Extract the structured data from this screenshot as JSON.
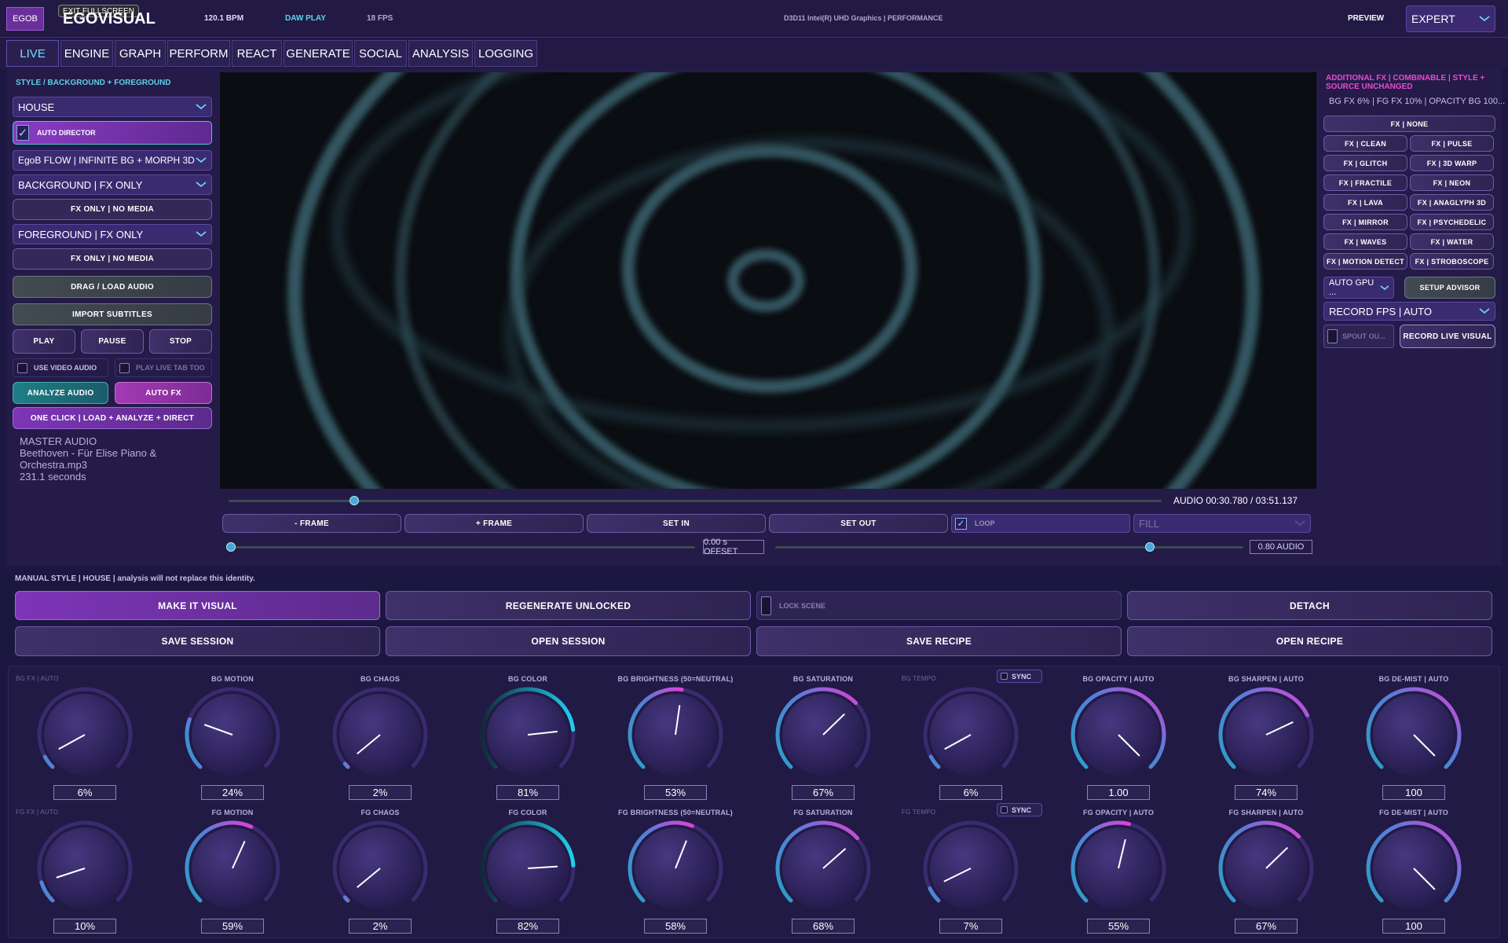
{
  "topbar": {
    "logo_badge": "EGOB",
    "exit_fullscreen": "EXIT FULLSCREEN",
    "app_title": "EGOVISUAL",
    "bpm": "120.1 BPM",
    "daw_play": "DAW PLAY",
    "fps": "18 FPS",
    "gpu": "D3D11  Intel(R) UHD Graphics | PERFORMANCE",
    "preview": "PREVIEW",
    "mode": "EXPERT"
  },
  "tabs": [
    "LIVE",
    "ENGINE",
    "GRAPH",
    "PERFORM",
    "REACT",
    "GENERATE",
    "SOCIAL",
    "ANALYSIS",
    "LOGGING"
  ],
  "left": {
    "section_label": "STYLE / BACKGROUND + FOREGROUND",
    "style_select": "HOUSE",
    "auto_director": "AUTO DIRECTOR",
    "flow_select": "EgoB FLOW | INFINITE BG + MORPH 3D",
    "background_select": "BACKGROUND | FX ONLY",
    "bg_media": "FX ONLY | NO MEDIA",
    "foreground_select": "FOREGROUND | FX ONLY",
    "fg_media": "FX ONLY | NO MEDIA",
    "load_audio": "DRAG / LOAD AUDIO",
    "import_subtitles": "IMPORT SUBTITLES",
    "play": "PLAY",
    "pause": "PAUSE",
    "stop": "STOP",
    "use_video_audio": "USE VIDEO AUDIO",
    "play_live_tab": "PLAY LIVE TAB TOO",
    "analyze_audio": "ANALYZE AUDIO",
    "auto_fx": "AUTO FX",
    "one_click": "ONE CLICK | LOAD + ANALYZE + DIRECT",
    "master_title": "MASTER AUDIO",
    "master_file_1": "Beethoven - Für Elise Piano &",
    "master_file_2": "Orchestra.mp3",
    "master_duration": "231.1 seconds"
  },
  "transport": {
    "audio_time": "AUDIO 00:30.780 / 03:51.137",
    "timeline_progress": 0.135,
    "minus_frame": "- FRAME",
    "plus_frame": "+ FRAME",
    "set_in": "SET IN",
    "set_out": "SET OUT",
    "loop": "LOOP",
    "fill_select": "FILL",
    "offset_progress": 0.0,
    "offset_value": "0.00 s OFFSET",
    "audio_progress": 0.8,
    "audio_value": "0.80 AUDIO"
  },
  "right": {
    "title": "ADDITIONAL FX | COMBINABLE | STYLE + SOURCE UNCHANGED",
    "status": "BG FX 6%  | FG FX 10%  | OPACITY BG 100...",
    "fx_none": "FX | NONE",
    "fx_buttons": [
      "FX | CLEAN",
      "FX | PULSE",
      "FX | GLITCH",
      "FX | 3D WARP",
      "FX | FRACTILE",
      "FX | NEON",
      "FX | LAVA",
      "FX | ANAGLYPH 3D",
      "FX | MIRROR",
      "FX | PSYCHEDELIC",
      "FX | WAVES",
      "FX | WATER",
      "FX | MOTION DETECT",
      "FX | STROBOSCOPE"
    ],
    "gpu_select": "AUTO GPU ...",
    "setup_advisor": "SETUP ADVISOR",
    "record_fps": "RECORD FPS | AUTO",
    "spout": "SPOUT OU...",
    "record_live": "RECORD LIVE VISUAL"
  },
  "bottom": {
    "manual_note": "MANUAL STYLE | HOUSE | analysis will not replace this identity.",
    "make_visual": "MAKE IT VISUAL",
    "regenerate": "REGENERATE UNLOCKED",
    "lock_scene": "LOCK SCENE",
    "detach": "DETACH",
    "save_session": "SAVE SESSION",
    "open_session": "OPEN SESSION",
    "save_recipe": "SAVE RECIPE",
    "open_recipe": "OPEN RECIPE",
    "sync": "SYNC"
  },
  "knobs_bg": [
    {
      "label": "BG FX | AUTO",
      "value": "6%",
      "level": 0.06,
      "dim": true
    },
    {
      "label": "BG MOTION",
      "value": "24%",
      "level": 0.24,
      "dim": false
    },
    {
      "label": "BG CHAOS",
      "value": "2%",
      "level": 0.02,
      "dim": false
    },
    {
      "label": "BG COLOR",
      "value": "81%",
      "level": 0.81,
      "dim": false
    },
    {
      "label": "BG BRIGHTNESS (50=NEUTRAL)",
      "value": "53%",
      "level": 0.53,
      "dim": false
    },
    {
      "label": "BG SATURATION",
      "value": "67%",
      "level": 0.67,
      "dim": false
    },
    {
      "label": "BG TEMPO",
      "value": "6%",
      "level": 0.06,
      "dim": true
    },
    {
      "label": "BG OPACITY | AUTO",
      "value": "1.00",
      "level": 1.0,
      "dim": false
    },
    {
      "label": "BG SHARPEN | AUTO",
      "value": "74%",
      "level": 0.74,
      "dim": false
    },
    {
      "label": "BG DE-MIST | AUTO",
      "value": "100",
      "level": 1.0,
      "dim": false
    }
  ],
  "knobs_fg": [
    {
      "label": "FG FX | AUTO",
      "value": "10%",
      "level": 0.1,
      "dim": true
    },
    {
      "label": "FG MOTION",
      "value": "59%",
      "level": 0.59,
      "dim": false
    },
    {
      "label": "FG CHAOS",
      "value": "2%",
      "level": 0.02,
      "dim": false
    },
    {
      "label": "FG COLOR",
      "value": "82%",
      "level": 0.82,
      "dim": false
    },
    {
      "label": "FG BRIGHTNESS (50=NEUTRAL)",
      "value": "58%",
      "level": 0.58,
      "dim": false
    },
    {
      "label": "FG SATURATION",
      "value": "68%",
      "level": 0.68,
      "dim": false
    },
    {
      "label": "FG TEMPO",
      "value": "7%",
      "level": 0.07,
      "dim": true
    },
    {
      "label": "FG OPACITY | AUTO",
      "value": "55%",
      "level": 0.55,
      "dim": false
    },
    {
      "label": "FG SHARPEN | AUTO",
      "value": "67%",
      "level": 0.67,
      "dim": false
    },
    {
      "label": "FG DE-MIST | AUTO",
      "value": "100",
      "level": 1.0,
      "dim": false
    }
  ]
}
